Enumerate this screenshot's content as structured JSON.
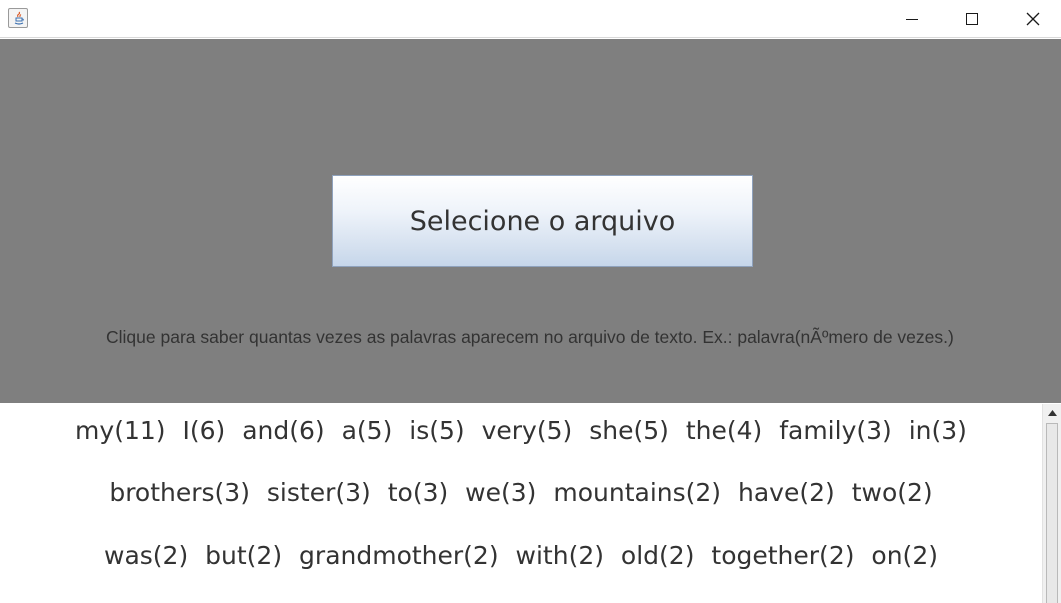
{
  "window": {
    "title": "",
    "icon": "java-app-icon",
    "controls": [
      "minimize-icon",
      "maximize-icon",
      "close-icon"
    ]
  },
  "main": {
    "select_button_label": "Selecione o arquivo",
    "hint": "Clique para saber quantas vezes as palavras aparecem no arquivo de texto. Ex.: palavra(nÃºmero de vezes.)"
  },
  "results": {
    "lines": [
      "my(11) I(6) and(6) a(5) is(5) very(5) she(5) the(4) family(3) in(3)",
      "brothers(3) sister(3) to(3) we(3) mountains(2) have(2) two(2)",
      "was(2) but(2) grandmother(2) with(2) old(2) together(2) on(2)"
    ]
  },
  "colors": {
    "panel_background": "#7f7f7f",
    "button_gradient_top": "#ffffff",
    "button_gradient_bottom": "#c6d6ea",
    "text": "#333333"
  }
}
